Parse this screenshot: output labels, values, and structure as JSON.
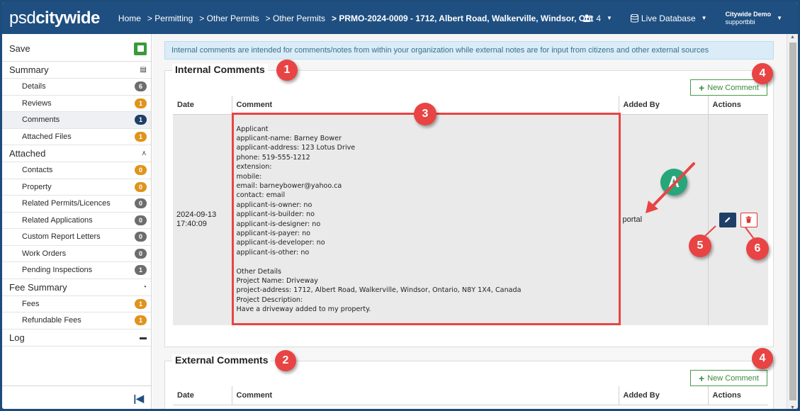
{
  "header": {
    "logo_part1": "psd",
    "logo_part2": "citywide",
    "breadcrumbs": [
      "Home",
      "> Permitting",
      "> Other Permits",
      "> Other Permits",
      "> PRMO-2024-0009 - 1712, Albert Road, Walkerville, Windsor, Ont"
    ],
    "users_count": "4",
    "database": "Live Database",
    "user_name": "Citywide Demo",
    "user_id": "supportbbi"
  },
  "sidebar": {
    "save": "Save",
    "summary": "Summary",
    "details": "Details",
    "details_count": "6",
    "reviews": "Reviews",
    "reviews_count": "1",
    "comments": "Comments",
    "comments_count": "1",
    "attached_files": "Attached Files",
    "attached_files_count": "1",
    "attached": "Attached",
    "contacts": "Contacts",
    "contacts_count": "0",
    "property": "Property",
    "property_count": "0",
    "related_permits": "Related Permits/Licences",
    "related_permits_count": "0",
    "related_apps": "Related Applications",
    "related_apps_count": "0",
    "custom_letters": "Custom Report Letters",
    "custom_letters_count": "0",
    "work_orders": "Work Orders",
    "work_orders_count": "0",
    "pending_inspections": "Pending Inspections",
    "pending_inspections_count": "1",
    "fee_summary": "Fee Summary",
    "fees": "Fees",
    "fees_count": "1",
    "refundable_fees": "Refundable Fees",
    "refundable_fees_count": "1",
    "log": "Log"
  },
  "main": {
    "info": "Internal comments are intended for comments/notes from within your organization while external notes are for input from citizens and other external sources",
    "internal_title": "Internal Comments",
    "external_title": "External Comments",
    "new_comment": "New Comment",
    "columns": [
      "Date",
      "Comment",
      "Added By",
      "Actions"
    ],
    "row": {
      "date": "2024-09-13\n17:40:09",
      "comment": "Applicant\napplicant-name: Barney Bower\napplicant-address: 123 Lotus Drive\nphone: 519-555-1212\nextension:\nmobile:\nemail: barneybower@yahoo.ca\ncontact: email\napplicant-is-owner: no\napplicant-is-builder: no\napplicant-is-designer: no\napplicant-is-payer: no\napplicant-is-developer: no\napplicant-is-other: no\n\nOther Details\nProject Name: Driveway\nproject-address: 1712, Albert Road, Walkerville, Windsor, Ontario, N8Y 1X4, Canada\nProject Description:\nHave a driveway added to my property.",
      "added_by": "portal"
    }
  },
  "annotations": {
    "n1": "1",
    "n2": "2",
    "n3": "3",
    "n4": "4",
    "n5": "5",
    "n6": "6",
    "nA": "A"
  }
}
